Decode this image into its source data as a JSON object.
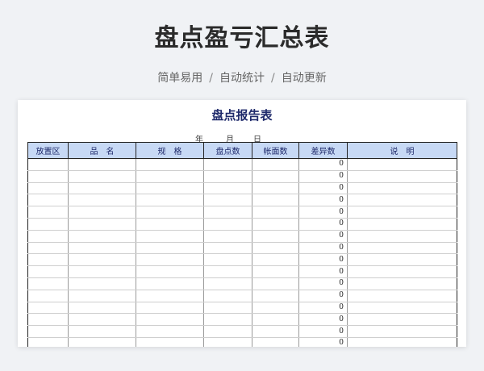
{
  "header": {
    "title": "盘点盈亏汇总表",
    "tags": [
      "简单易用",
      "自动统计",
      "自动更新"
    ],
    "separator": "/"
  },
  "sheet": {
    "title": "盘点报告表",
    "date": {
      "year": "年",
      "month": "月",
      "day": "日"
    },
    "columns": [
      "放置区",
      "品　名",
      "规　格",
      "盘点数",
      "帐面数",
      "差异数",
      "说　明"
    ],
    "rows": [
      [
        "",
        "",
        "",
        "",
        "",
        "0",
        ""
      ],
      [
        "",
        "",
        "",
        "",
        "",
        "0",
        ""
      ],
      [
        "",
        "",
        "",
        "",
        "",
        "0",
        ""
      ],
      [
        "",
        "",
        "",
        "",
        "",
        "0",
        ""
      ],
      [
        "",
        "",
        "",
        "",
        "",
        "0",
        ""
      ],
      [
        "",
        "",
        "",
        "",
        "",
        "0",
        ""
      ],
      [
        "",
        "",
        "",
        "",
        "",
        "0",
        ""
      ],
      [
        "",
        "",
        "",
        "",
        "",
        "0",
        ""
      ],
      [
        "",
        "",
        "",
        "",
        "",
        "0",
        ""
      ],
      [
        "",
        "",
        "",
        "",
        "",
        "0",
        ""
      ],
      [
        "",
        "",
        "",
        "",
        "",
        "0",
        ""
      ],
      [
        "",
        "",
        "",
        "",
        "",
        "0",
        ""
      ],
      [
        "",
        "",
        "",
        "",
        "",
        "0",
        ""
      ],
      [
        "",
        "",
        "",
        "",
        "",
        "0",
        ""
      ],
      [
        "",
        "",
        "",
        "",
        "",
        "0",
        ""
      ],
      [
        "",
        "",
        "",
        "",
        "",
        "0",
        ""
      ]
    ]
  }
}
